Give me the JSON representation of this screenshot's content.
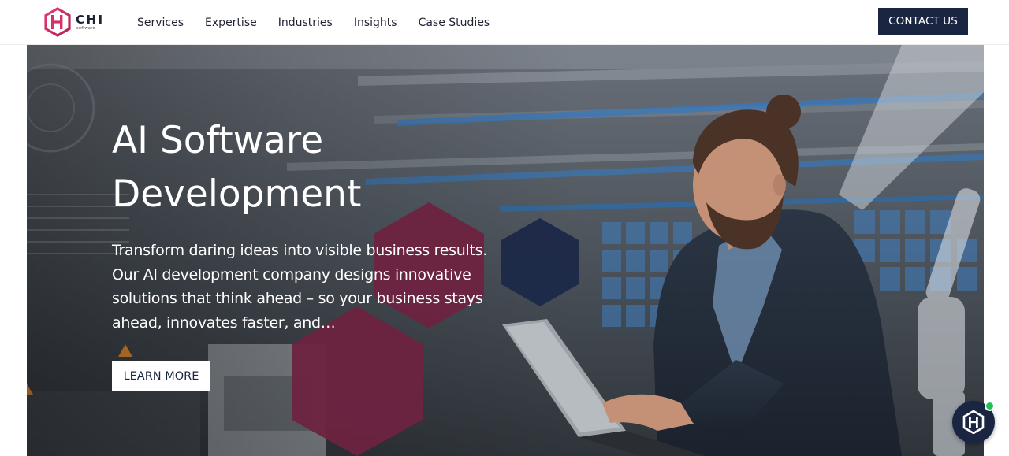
{
  "header": {
    "logo_text": "CHI",
    "logo_subtext": "software",
    "nav": [
      {
        "label": "Services"
      },
      {
        "label": "Expertise"
      },
      {
        "label": "Industries"
      },
      {
        "label": "Insights"
      },
      {
        "label": "Case Studies"
      }
    ],
    "contact_label": "CONTACT US"
  },
  "hero": {
    "title": "AI Software\nDevelopment",
    "description": "Transform daring ideas into visible business results. Our AI development company designs innovative solutions that think ahead – so your business stays ahead, innovates faster, and…",
    "cta_label": "LEARN MORE",
    "background_image": "man-with-laptop-in-factory",
    "hexagon_colors": [
      "#6e2340",
      "#1b2848"
    ]
  },
  "chat_widget": {
    "icon": "chi-logo-icon",
    "status_color": "#1fc153"
  },
  "colors": {
    "brand_navy": "#1a2542",
    "brand_magenta": "#d63069",
    "hex_burgundy": "#6e2340",
    "hex_navy": "#1b2848"
  }
}
